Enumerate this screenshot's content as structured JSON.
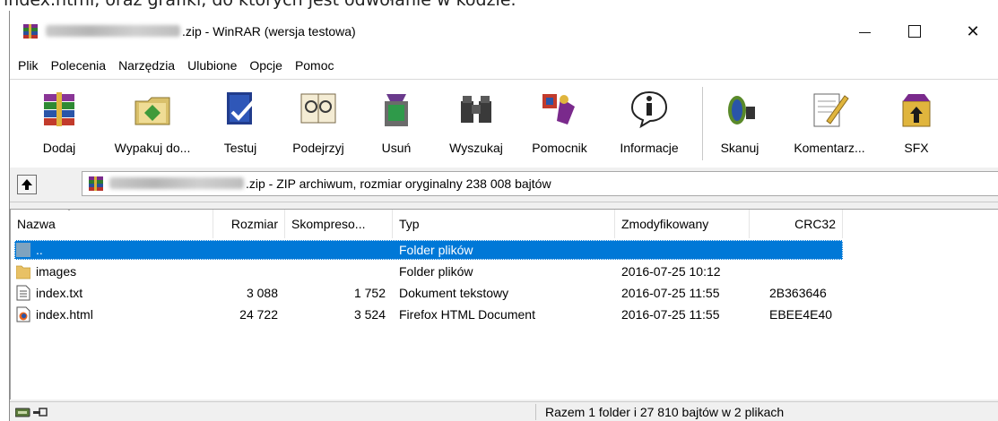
{
  "top_strip_text": "index.html, oraz grafiki, do których jest odwołanie w kodzie.",
  "window": {
    "title_suffix": ".zip - WinRAR (wersja testowa)",
    "controls": {
      "minimize": "—",
      "maximize": "☐",
      "close": "✕"
    }
  },
  "menu": [
    "Plik",
    "Polecenia",
    "Narzędzia",
    "Ulubione",
    "Opcje",
    "Pomoc"
  ],
  "toolbar": {
    "add": "Dodaj",
    "extract": "Wypakuj do...",
    "test": "Testuj",
    "view": "Podejrzyj",
    "delete": "Usuń",
    "find": "Wyszukaj",
    "wizard": "Pomocnik",
    "info": "Informacje",
    "scan": "Skanuj",
    "comment": "Komentarz...",
    "sfx": "SFX"
  },
  "address": {
    "text_suffix": ".zip - ZIP archiwum, rozmiar oryginalny 238 008 bajtów"
  },
  "list": {
    "columns": {
      "name": "Nazwa",
      "size": "Rozmiar",
      "packed": "Skompreso...",
      "type": "Typ",
      "modified": "Zmodyfikowany",
      "crc": "CRC32"
    },
    "rows": [
      {
        "name": "..",
        "size": "",
        "packed": "",
        "type": "Folder plików",
        "modified": "",
        "crc": "",
        "icon": "folder-up-icon",
        "selected": true
      },
      {
        "name": "images",
        "size": "",
        "packed": "",
        "type": "Folder plików",
        "modified": "2016-07-25 10:12",
        "crc": "",
        "icon": "folder-icon"
      },
      {
        "name": "index.txt",
        "size": "3 088",
        "packed": "1 752",
        "type": "Dokument tekstowy",
        "modified": "2016-07-25 11:55",
        "crc": "2B363646",
        "icon": "text-file-icon"
      },
      {
        "name": "index.html",
        "size": "24 722",
        "packed": "3 524",
        "type": "Firefox HTML Document",
        "modified": "2016-07-25 11:55",
        "crc": "EBEE4E40",
        "icon": "firefox-file-icon"
      }
    ]
  },
  "status": {
    "summary": "Razem 1 folder i 27 810 bajtów w 2 plikach"
  },
  "colors": {
    "selection": "#0078d7",
    "window_bg": "#f0f0f0",
    "folder": "#e8c165"
  }
}
